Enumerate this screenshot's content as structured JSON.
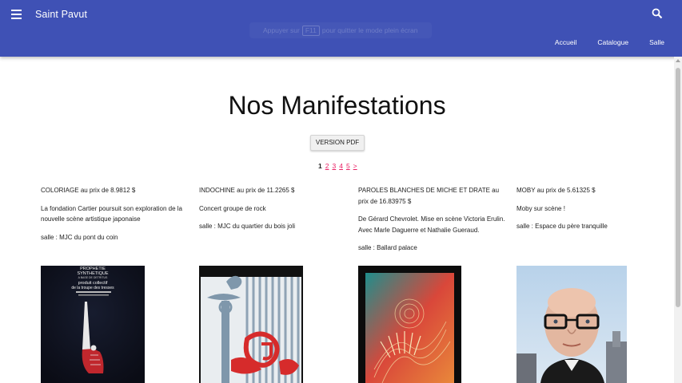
{
  "header": {
    "brand": "Saint Pavut",
    "toast": {
      "before": "Appuyer sur",
      "key": "F11",
      "after": "pour quitter le mode plein écran"
    },
    "nav": [
      "Accueil",
      "Catalogue",
      "Salle"
    ]
  },
  "main": {
    "title": "Nos Manifestations",
    "pdf_button": "VERSION PDF",
    "pagination": {
      "current": "1",
      "pages": [
        "2",
        "3",
        "4",
        "5"
      ],
      "next": ">"
    }
  },
  "events": [
    {
      "name": "COLORIAGE",
      "price_text": "au prix de 8.9812 $",
      "description": "La fondation Cartier poursuit son exploration de la nouvelle scène artistique japonaise",
      "venue": "salle : MJC du pont du coin",
      "poster_text": [
        "PROPHETIE",
        "SYNTHETIQUE",
        "A BASE DE DETRITUS",
        "produit collectif",
        "de la troupe des tresses"
      ]
    },
    {
      "name": "INDOCHINE",
      "price_text": "au prix de 11.2265 $",
      "description": "Concert groupe de rock",
      "venue": "salle : MJC du quartier du bois joli"
    },
    {
      "name": "PAROLES BLANCHES DE MICHE ET DRATE",
      "price_text": "au prix de 16.83975 $",
      "description": "De Gérard Chevrolet. Mise en scène Victoria Erulin. Avec Marle Daguerre et Nathalie Gueraud.",
      "venue": "salle : Ballard palace"
    },
    {
      "name": "MOBY",
      "price_text": "au prix de 5.61325 $",
      "description": "Moby sur scène !",
      "venue": "salle : Espace du père tranquille"
    }
  ],
  "colors": {
    "appbar": "#3f51b5",
    "link": "#e91e63"
  },
  "icons": {
    "menu": "menu-icon",
    "search": "search-icon"
  }
}
